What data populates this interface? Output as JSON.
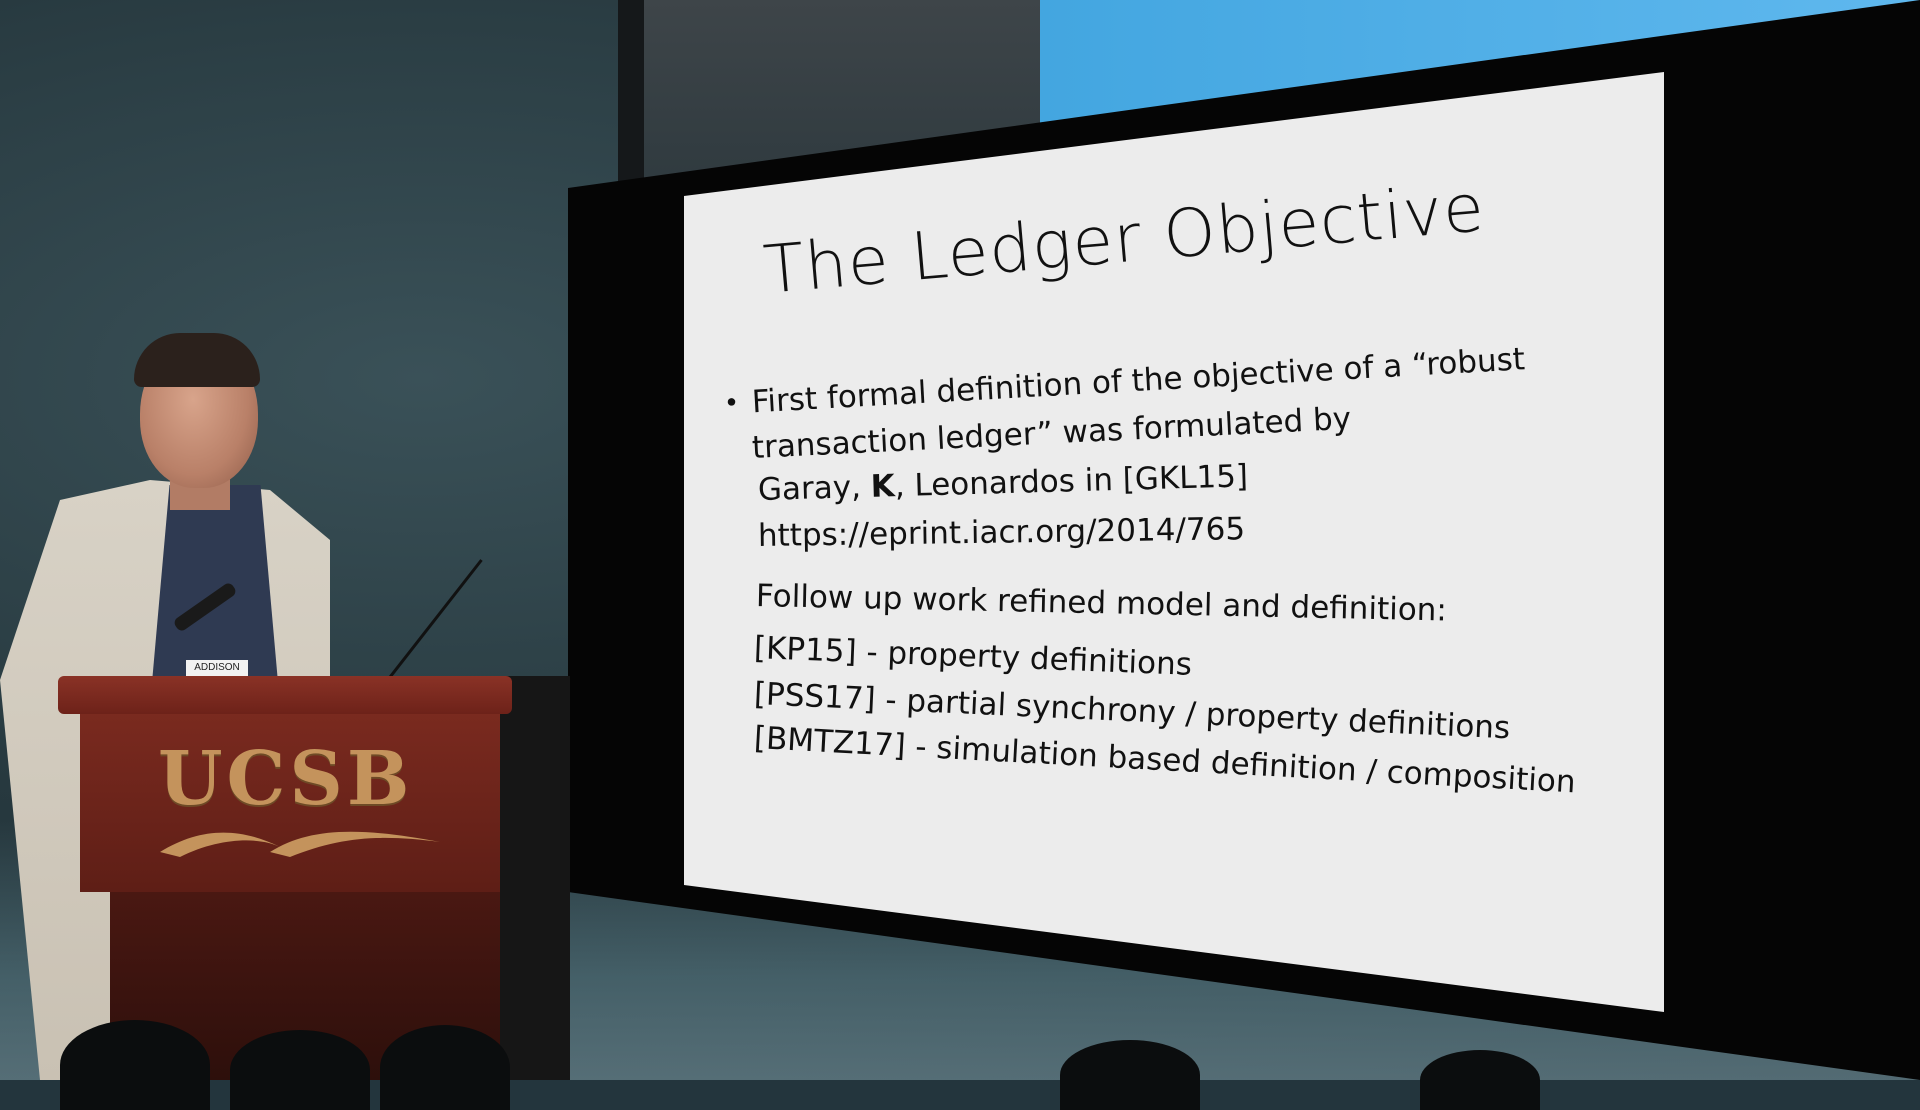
{
  "slide": {
    "title": "The Ledger Objective",
    "bullet_line1": "First formal definition of the objective of a “robust",
    "bullet_line2": "transaction ledger” was formulated by",
    "authors_prefix": "Garay, ",
    "authors_bold": "K",
    "authors_suffix": ", Leonardos in [GKL15]",
    "link": "https://eprint.iacr.org/2014/765",
    "followup_heading": "Follow up work refined model and definition:",
    "refs": [
      "[KP15] - property definitions",
      "[PSS17] - partial synchrony / property definitions",
      "[BMTZ17] - simulation based definition / composition"
    ]
  },
  "podium": {
    "logo_text": "UCSB",
    "label": "ADDISON"
  },
  "colors": {
    "podium": "#6d2219",
    "logo": "#c4935c",
    "slide_bg": "#ececec",
    "blue_panel": "#4fb0e8"
  }
}
